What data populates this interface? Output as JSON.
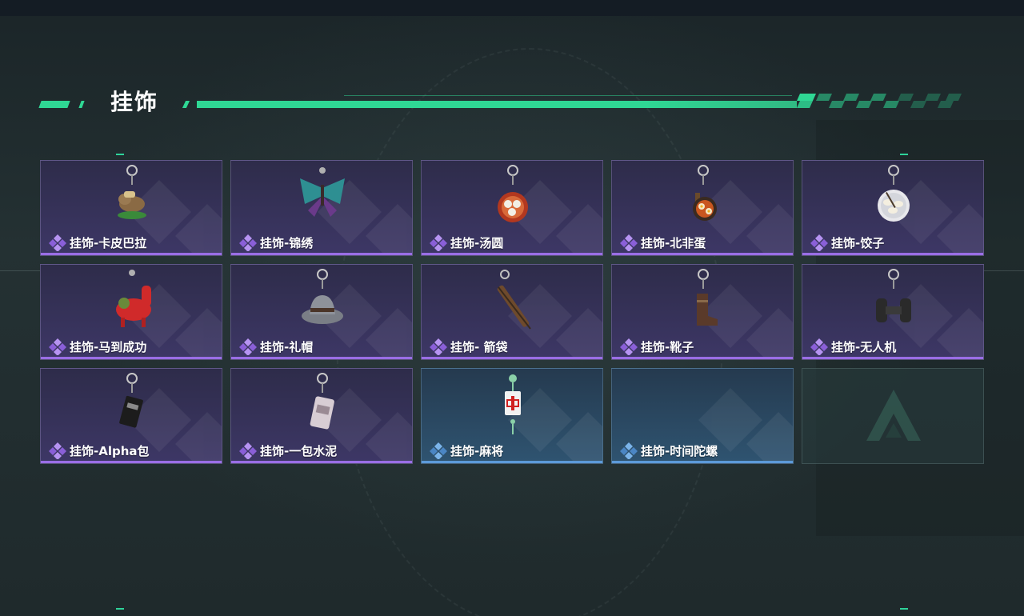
{
  "section": {
    "title": "挂饰"
  },
  "items": [
    {
      "label": "挂饰-卡皮巴拉",
      "rarity": "purple",
      "icon": "capybara-charm-icon"
    },
    {
      "label": "挂饰-锦绣",
      "rarity": "purple",
      "icon": "butterfly-charm-icon"
    },
    {
      "label": "挂饰-汤圆",
      "rarity": "purple",
      "icon": "tangyuan-bowl-charm-icon"
    },
    {
      "label": "挂饰-北非蛋",
      "rarity": "purple",
      "icon": "shakshuka-pan-charm-icon"
    },
    {
      "label": "挂饰-饺子",
      "rarity": "purple",
      "icon": "dumplings-plate-charm-icon"
    },
    {
      "label": "挂饰-马到成功",
      "rarity": "purple",
      "icon": "red-horse-charm-icon"
    },
    {
      "label": "挂饰-礼帽",
      "rarity": "purple",
      "icon": "fedora-hat-charm-icon"
    },
    {
      "label": "挂饰- 箭袋",
      "rarity": "purple",
      "icon": "quiver-charm-icon"
    },
    {
      "label": "挂饰-靴子",
      "rarity": "purple",
      "icon": "boot-charm-icon"
    },
    {
      "label": "挂饰-无人机",
      "rarity": "purple",
      "icon": "drone-wheels-charm-icon"
    },
    {
      "label": "挂饰-Alpha包",
      "rarity": "purple",
      "icon": "alpha-bag-charm-icon"
    },
    {
      "label": "挂饰-一包水泥",
      "rarity": "purple",
      "icon": "cement-bag-charm-icon"
    },
    {
      "label": "挂饰-麻将",
      "rarity": "blue",
      "icon": "mahjong-tile-charm-icon"
    },
    {
      "label": "挂饰-时间陀螺",
      "rarity": "blue",
      "icon": "spinning-top-charm-icon"
    },
    {
      "label": "",
      "rarity": "empty",
      "icon": "game-logo-icon"
    }
  ],
  "colors": {
    "accent_green": "#2fd794",
    "purple_rarity": "#9a6ee6",
    "blue_rarity": "#5c9ad9"
  }
}
